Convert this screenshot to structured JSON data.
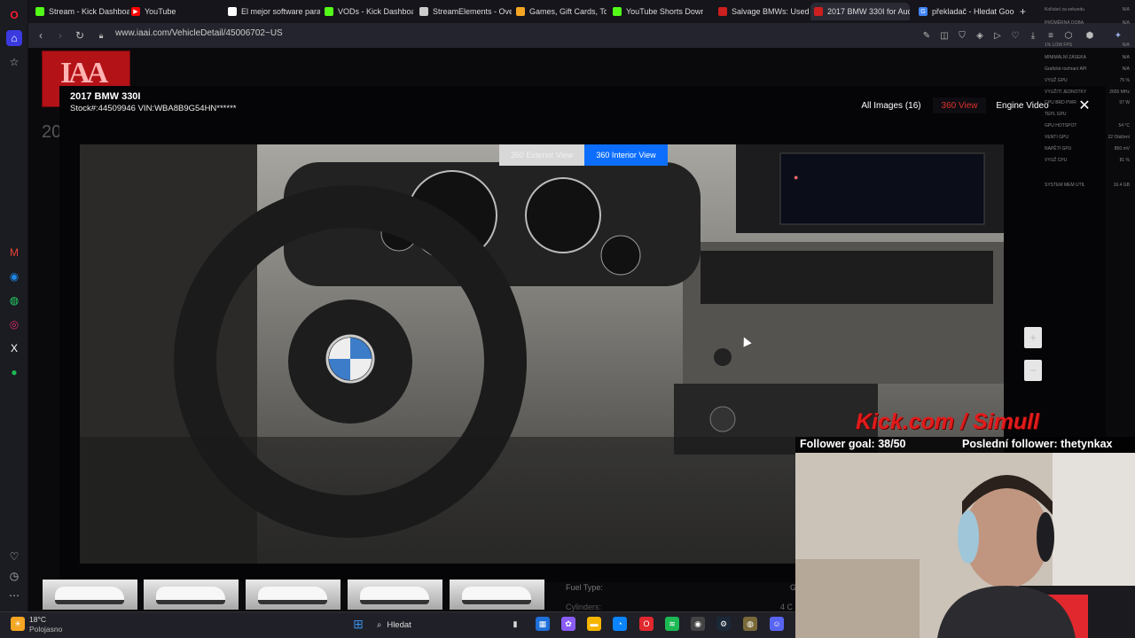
{
  "browser": {
    "tabs": [
      {
        "label": "Stream - Kick Dashboard",
        "favicon_color": "#53fc18",
        "icon": "kick-icon"
      },
      {
        "label": "YouTube",
        "favicon_color": "#ff0000",
        "icon": "youtube-icon"
      },
      {
        "label": "El mejor software para p",
        "favicon_color": "#ffffff",
        "icon": "software-icon"
      },
      {
        "label": "VODs - Kick Dashboard",
        "favicon_color": "#53fc18",
        "icon": "kick-icon"
      },
      {
        "label": "StreamElements - Overla",
        "favicon_color": "#cccccc",
        "icon": "streamelements-icon"
      },
      {
        "label": "Games, Gift Cards, Top-U",
        "favicon_color": "#f5a623",
        "icon": "games-icon"
      },
      {
        "label": "YouTube Shorts Downlo",
        "favicon_color": "#53fc18",
        "icon": "download-icon"
      },
      {
        "label": "Salvage BMWs: Used, Re",
        "favicon_color": "#cc1f1f",
        "icon": "iaai-icon"
      },
      {
        "label": "2017 BMW 330I for Auctio",
        "favicon_color": "#cc1f1f",
        "icon": "iaai-icon"
      },
      {
        "label": "překladač - Hledat Goog",
        "favicon_color": "#4285f4",
        "icon": "google-icon"
      }
    ],
    "new_tab": "+",
    "url": "www.iaai.com/VehicleDetail/45006702~US"
  },
  "page": {
    "partial_heading": "20",
    "vehicle_title": "2017 BMW 330I",
    "stock_vin": "Stock#:44509946   VIN:WBA8B9G54HN******",
    "tabs": {
      "all_images": "All Images (16)",
      "view_360": "360 View",
      "engine_video": "Engine Video"
    },
    "viewer_tabs": {
      "exterior": "360 Exterior View",
      "interior": "360 Interior View"
    },
    "zoom_in": "+",
    "zoom_out": "−",
    "fuel_type_label": "Fuel Type:",
    "cylinders_label": "Cylinders:",
    "cylinders_value_partial": "4 C",
    "fuel_value_partial": "G",
    "accent_color": "#0d6efd",
    "active_tab_color": "#e0312b"
  },
  "hw_stats": [
    {
      "label": "Kolísání za sekundu",
      "value": "N/A"
    },
    {
      "label": "PRŮMĚRNÁ DOBA",
      "value": "N/A"
    },
    {
      "label": "1% LOW FPS",
      "value": "N/A"
    },
    {
      "label": "MINIMÁLNÍ ZÁSEKA",
      "value": "N/A"
    },
    {
      "label": "Grafické rozhraní API",
      "value": "N/A"
    },
    {
      "label": "VYUŽ GPU",
      "value": "75 %"
    },
    {
      "label": "VYUŽITÍ JEDNOTKY",
      "value": "2655 MHz"
    },
    {
      "label": "GPU BRD PWR",
      "value": "97 W"
    },
    {
      "label": "TEPL GPU",
      "value": ""
    },
    {
      "label": "GPU HOTSPOT",
      "value": "54 °C"
    },
    {
      "label": "VENTI GPU",
      "value": "22 Otáčení"
    },
    {
      "label": "NAPĚTÍ GPU",
      "value": "850 mV"
    },
    {
      "label": "VYUŽ CPU",
      "value": "81 %"
    },
    {
      "label": "SYSTEM MEM UTIL",
      "value": "16.4 GB"
    }
  ],
  "stream_overlay": {
    "kick_text": "Kick.com / Simull",
    "follower_goal": "Follower goal: 38/50",
    "last_follower": "Poslední follower: thetynkax"
  },
  "taskbar": {
    "weather_temp": "18°C",
    "weather_desc": "Polojasno",
    "search_placeholder": "Hledat"
  }
}
